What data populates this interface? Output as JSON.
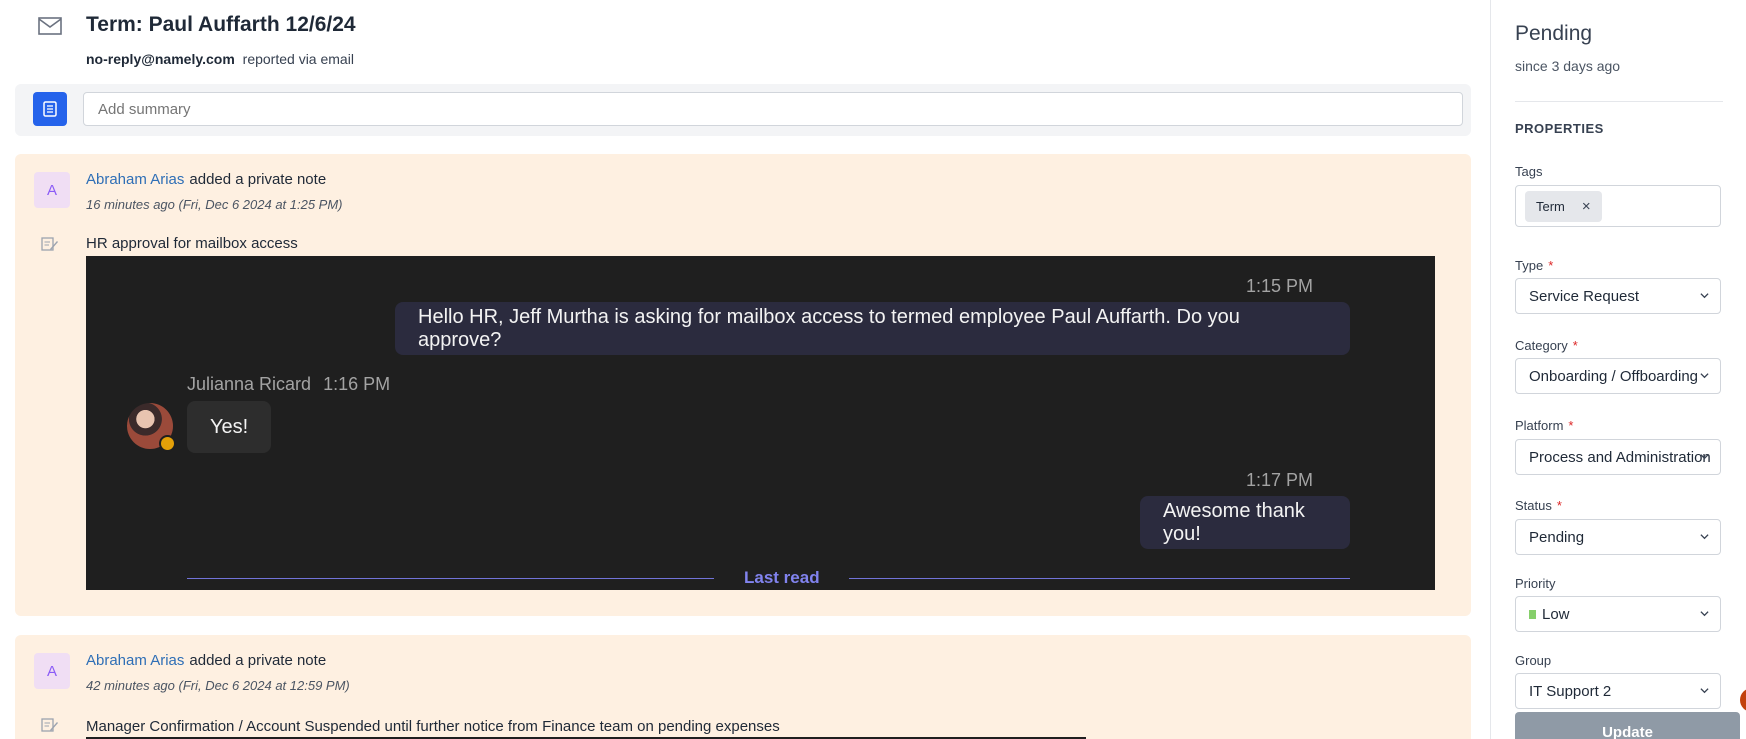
{
  "ticket": {
    "title": "Term: Paul Auffarth 12/6/24",
    "reporter_email": "no-reply@namely.com",
    "reported_via": "reported via email"
  },
  "summary": {
    "placeholder": "Add summary"
  },
  "notes": [
    {
      "avatar_letter": "A",
      "author": "Abraham Arias",
      "action": "added a private note",
      "time": "16 minutes ago (Fri, Dec 6 2024 at 1:25 PM)",
      "body": "HR approval for mailbox access",
      "chat": {
        "msg1_time": "1:15 PM",
        "msg1_text": "Hello HR, Jeff Murtha is asking for mailbox access to termed employee Paul Auffarth. Do you approve?",
        "reply_name": "Julianna Ricard",
        "reply_time": "1:16 PM",
        "reply_text": "Yes!",
        "msg2_time": "1:17 PM",
        "msg2_text": "Awesome thank you!",
        "last_read": "Last read"
      }
    },
    {
      "avatar_letter": "A",
      "author": "Abraham Arias",
      "action": "added a private note",
      "time": "42 minutes ago (Fri, Dec 6 2024 at 12:59 PM)",
      "body": "Manager Confirmation / Account Suspended until further notice from Finance team on pending expenses"
    }
  ],
  "sidebar": {
    "status_title": "Pending",
    "since": "since 3 days ago",
    "properties_heading": "PROPERTIES",
    "tags_label": "Tags",
    "tags": [
      "Term"
    ],
    "type_label": "Type",
    "type_value": "Service Request",
    "category_label": "Category",
    "category_value": "Onboarding / Offboarding",
    "platform_label": "Platform",
    "platform_value": "Process and Administration",
    "status_label": "Status",
    "status_value": "Pending",
    "priority_label": "Priority",
    "priority_value": "Low",
    "group_label": "Group",
    "group_value": "IT Support 2",
    "required_mark": "*",
    "update_label": "Update"
  },
  "colors": {
    "accent": "#2563eb",
    "note_bg": "#fef0e1",
    "author_link": "#2f6fb6",
    "priority_low": "#86cf6b",
    "required": "#dc2626"
  }
}
